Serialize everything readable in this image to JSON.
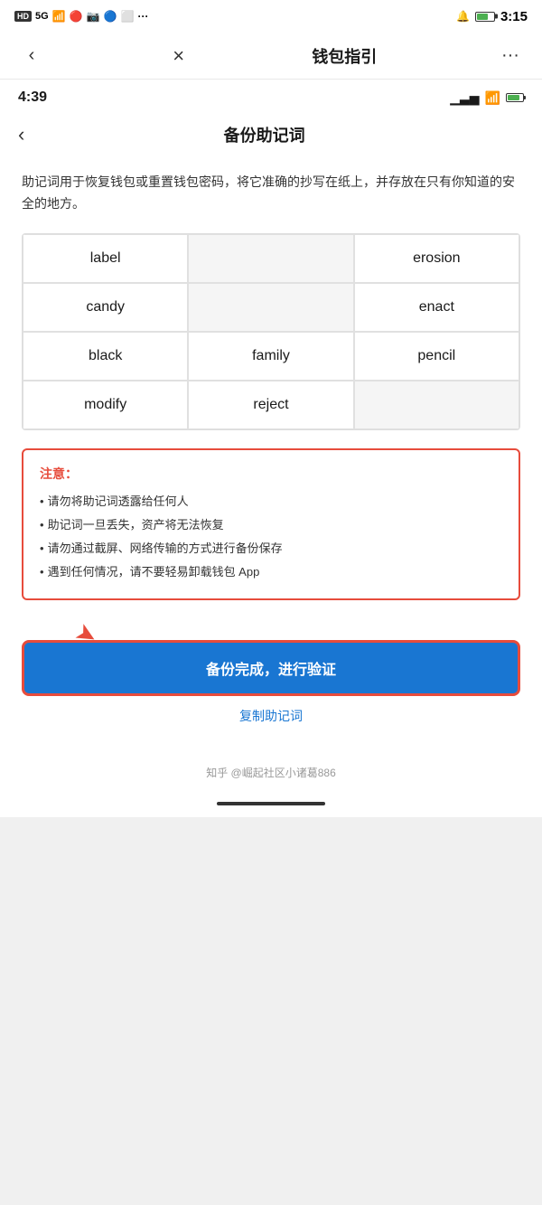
{
  "device": {
    "status_bar": {
      "hd_label": "HD",
      "signal": "5G",
      "time": "3:15",
      "icons": [
        "bell",
        "battery",
        "wifi"
      ]
    }
  },
  "app": {
    "topbar": {
      "back_label": "‹",
      "close_label": "×",
      "title": "钱包指引",
      "more_label": "···"
    }
  },
  "inner_screen": {
    "status_bar": {
      "time": "4:39"
    },
    "appbar": {
      "back_label": "‹",
      "title": "备份助记词"
    },
    "description": "助记词用于恢复钱包或重置钱包密码，将它准确的抄写在纸上，并存放在只有你知道的安全的地方。",
    "word_grid": [
      {
        "word": "label",
        "col": 1
      },
      {
        "word": "",
        "col": 2
      },
      {
        "word": "erosion",
        "col": 3
      },
      {
        "word": "candy",
        "col": 1
      },
      {
        "word": "",
        "col": 2
      },
      {
        "word": "enact",
        "col": 3
      },
      {
        "word": "black",
        "col": 1
      },
      {
        "word": "family",
        "col": 2
      },
      {
        "word": "pencil",
        "col": 3
      },
      {
        "word": "modify",
        "col": 1
      },
      {
        "word": "reject",
        "col": 2
      },
      {
        "word": "",
        "col": 3
      }
    ],
    "warning": {
      "title": "注意：",
      "items": [
        "请勿将助记词透露给任何人",
        "助记词一旦丢失，资产将无法恢复",
        "请勿通过截屏、网络传输的方式进行备份保存",
        "遇到任何情况，请不要轻易卸载钱包 App"
      ]
    },
    "buttons": {
      "primary_label": "备份完成，进行验证",
      "copy_label": "复制助记词"
    },
    "watermark": "知乎 @崛起社区小诸葛886"
  }
}
